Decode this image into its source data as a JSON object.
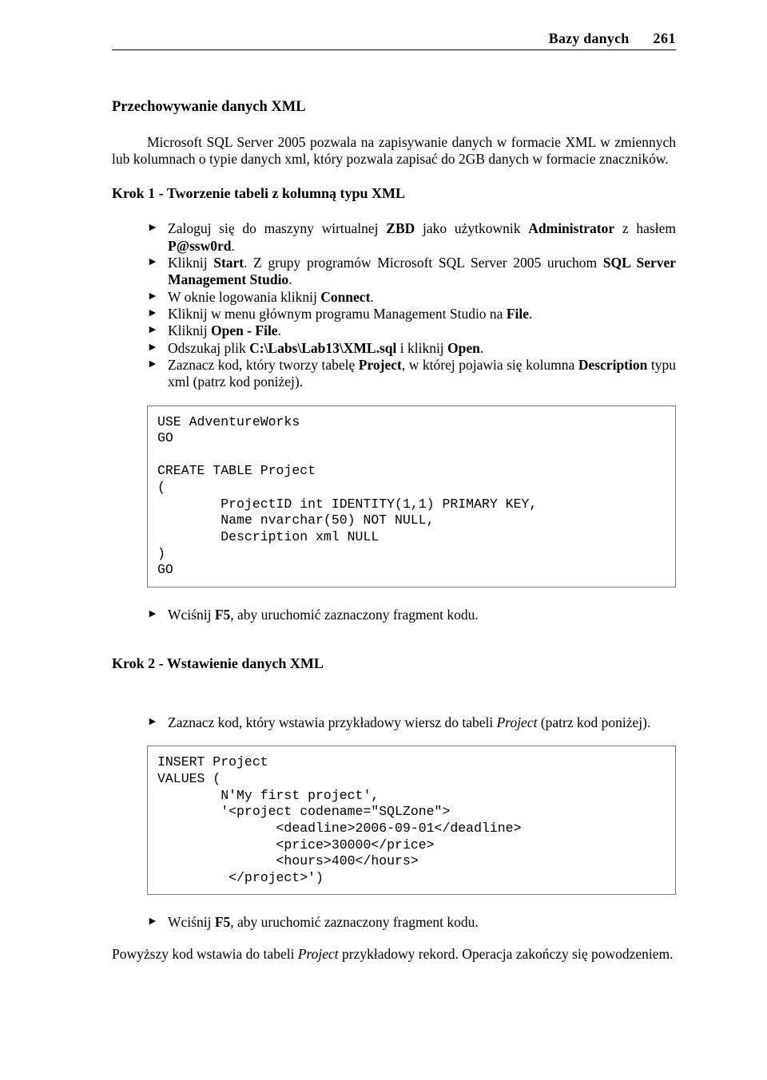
{
  "header": {
    "chapter": "Bazy danych",
    "page": "261"
  },
  "section_title": "Przechowywanie danych XML",
  "intro_para_html": "Microsoft SQL Server 2005 pozwala na zapisywanie danych w formacie XML w zmiennych lub kolumnach o typie danych xml, który pozwala zapisać do 2GB danych w formacie znaczników.",
  "step1": {
    "title": "Krok 1 - Tworzenie tabeli z kolumną typu XML",
    "items_html": [
      "Zaloguj się do maszyny wirtualnej <b>ZBD</b> jako użytkownik <b>Administrator</b> z hasłem <b>P@ssw0rd</b>.",
      "Kliknij <b>Start</b>. Z grupy programów Microsoft SQL Server 2005 uruchom <b>SQL Server Management Studio</b>.",
      "W oknie logowania kliknij <b>Connect</b>.",
      "Kliknij w menu głównym programu Management Studio na <b>File</b>.",
      "Kliknij <b>Open - File</b>.",
      "Odszukaj plik <b>C:\\Labs\\Lab13\\XML.sql</b> i kliknij <b>Open</b>.",
      "Zaznacz kod, który tworzy tabelę <b>Project</b>, w której pojawia się kolumna <b>Description</b> typu xml (patrz kod poniżej)."
    ],
    "code": "USE AdventureWorks\nGO\n\nCREATE TABLE Project\n(\n        ProjectID int IDENTITY(1,1) PRIMARY KEY,\n        Name nvarchar(50) NOT NULL,\n        Description xml NULL\n)\nGO",
    "post_items_html": [
      "Wciśnij <b>F5</b>, aby uruchomić zaznaczony fragment kodu."
    ]
  },
  "step2": {
    "title": "Krok 2 - Wstawienie danych XML",
    "items_html": [
      "Zaznacz kod, który wstawia przykładowy wiersz do tabeli <i>Project</i> (patrz kod poniżej)."
    ],
    "code": "INSERT Project\nVALUES (\n        N'My first project',\n        '<project codename=\"SQLZone\">\n               <deadline>2006-09-01</deadline>\n               <price>30000</price>\n               <hours>400</hours>\n         </project>')",
    "post_items_html": [
      "Wciśnij <b>F5</b>, aby uruchomić zaznaczony fragment kodu."
    ],
    "closing_para_html": "Powyższy kod wstawia do tabeli <i>Project</i> przykładowy rekord. Operacja zakończy się powodzeniem."
  }
}
